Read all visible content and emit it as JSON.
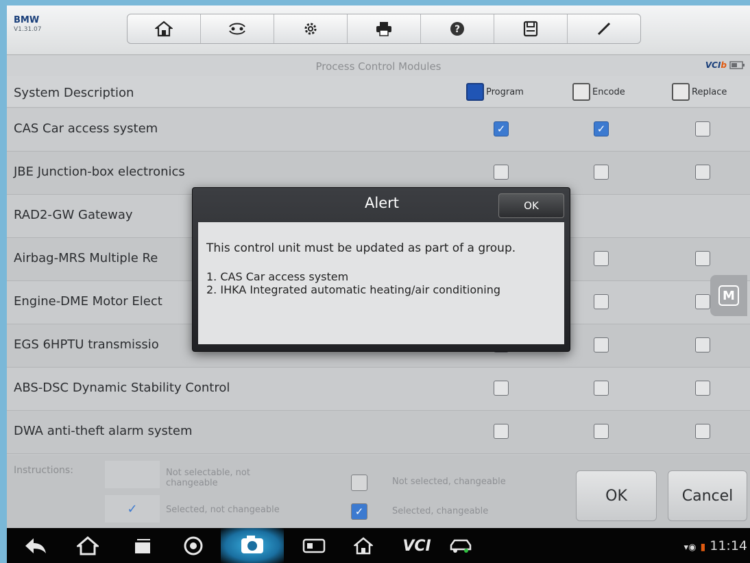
{
  "header": {
    "brand": "BMW",
    "version": "V1.31.07",
    "toolbar": [
      {
        "name": "home-icon",
        "glyph": "⌂"
      },
      {
        "name": "vehicle-swap-icon",
        "glyph": "⇆"
      },
      {
        "name": "settings-gear-icon",
        "glyph": "⚙"
      },
      {
        "name": "print-icon",
        "glyph": "⎙"
      },
      {
        "name": "help-icon",
        "glyph": "?"
      },
      {
        "name": "save-icon",
        "glyph": "▭"
      },
      {
        "name": "edit-pen-icon",
        "glyph": "/"
      }
    ],
    "subtitle": "Process Control Modules",
    "vci_label": "VCI",
    "vci_b": "b"
  },
  "table": {
    "header_title": "System Description",
    "columns": [
      {
        "label": "Program",
        "checked": true
      },
      {
        "label": "Encode",
        "checked": false
      },
      {
        "label": "Replace",
        "checked": false
      }
    ],
    "rows": [
      {
        "label": "CAS Car access system",
        "program": true,
        "encode": true,
        "replace": false
      },
      {
        "label": "JBE Junction-box electronics",
        "program": false,
        "encode": false,
        "replace": false
      },
      {
        "label": "RAD2-GW Gateway",
        "program": null,
        "encode": null,
        "replace": null
      },
      {
        "label": "Airbag-MRS Multiple Re",
        "program": null,
        "encode": false,
        "replace": false
      },
      {
        "label": "Engine-DME Motor Elect",
        "program": null,
        "encode": false,
        "replace": false
      },
      {
        "label": "EGS 6HPTU transmissio",
        "program": false,
        "encode": false,
        "replace": false
      },
      {
        "label": "ABS-DSC Dynamic Stability Control",
        "program": false,
        "encode": false,
        "replace": false
      },
      {
        "label": "DWA anti-theft alarm system",
        "program": false,
        "encode": false,
        "replace": false
      }
    ]
  },
  "instructions": {
    "label": "Instructions:",
    "not_selectable": "Not selectable, not changeable",
    "not_selectable_line1": "Not selectable, not",
    "not_selectable_line2": "changeable",
    "selected_not_changeable": "Selected, not changeable",
    "not_selected_changeable": "Not selected, changeable",
    "selected_changeable": "Selected, changeable",
    "ok": "OK",
    "cancel": "Cancel"
  },
  "alert": {
    "title": "Alert",
    "ok": "OK",
    "message": "This control unit must be updated as part of a group.",
    "items": [
      "1. CAS Car access system",
      "2. IHKA Integrated automatic heating/air conditioning"
    ]
  },
  "side_button": "M",
  "navbar": {
    "time": "11:14",
    "vci": "VCI"
  },
  "colors": {
    "accent": "#2055b5",
    "checked": "#3c7ad0",
    "frame": "#7ab8d8"
  }
}
